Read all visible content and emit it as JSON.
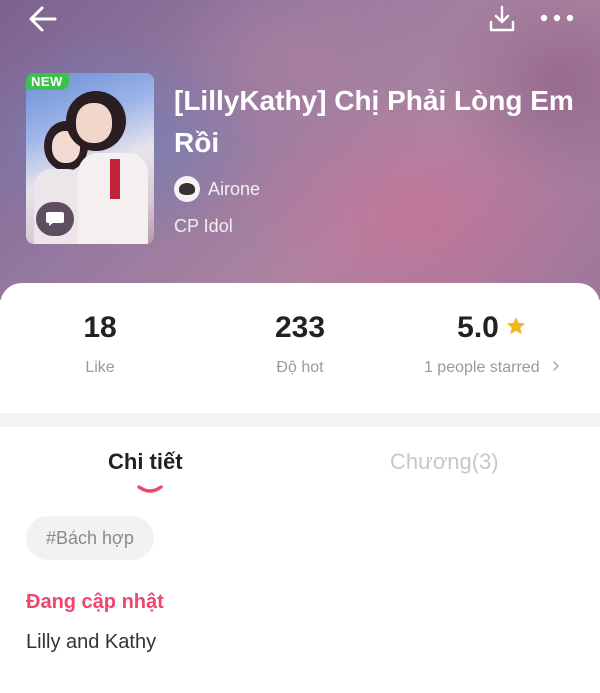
{
  "header": {
    "icons": {
      "back": "back-arrow-icon",
      "download": "download-icon",
      "more": "more-icon"
    }
  },
  "book": {
    "badge": "NEW",
    "title": "[LillyKathy] Chị Phải Lòng Em Rồi",
    "author": "Airone",
    "category": "CP Idol"
  },
  "stats": {
    "likes": {
      "value": "18",
      "label": "Like"
    },
    "hot": {
      "value": "233",
      "label": "Độ hot"
    },
    "rating": {
      "value": "5.0",
      "label": "1 people starred"
    }
  },
  "tabs": {
    "details": "Chi tiết",
    "chapters": "Chương(3)",
    "active": "details"
  },
  "details": {
    "tag": "#Bách hợp",
    "status": "Đang cập nhật",
    "description": "Lilly and Kathy"
  },
  "colors": {
    "accent": "#f0466e",
    "star": "#f5b623",
    "new_badge": "#3fbf4e"
  }
}
